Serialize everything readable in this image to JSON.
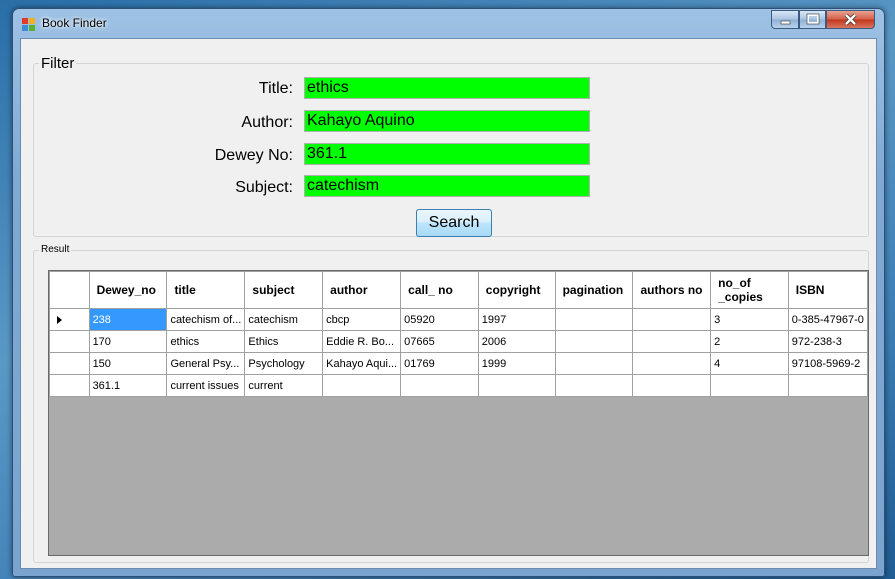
{
  "window": {
    "title": "Book Finder"
  },
  "filter": {
    "legend": "Filter",
    "fields": [
      {
        "label": "Title:",
        "value": "ethics"
      },
      {
        "label": "Author:",
        "value": "Kahayo Aquino"
      },
      {
        "label": "Dewey No:",
        "value": "361.1"
      },
      {
        "label": "Subject:",
        "value": "catechism"
      }
    ],
    "search_label": "Search",
    "input_color": "#00ff00"
  },
  "result": {
    "legend": "Result",
    "columns": [
      "Dewey_no",
      "title",
      "subject",
      "author",
      "call_ no",
      "copyright",
      "pagination",
      "authors no",
      "no_of _copies",
      "ISBN"
    ],
    "rows": [
      [
        "238",
        "catechism of...",
        "catechism",
        "cbcp",
        "05920",
        "1997",
        "",
        "",
        "3",
        "0-385-47967-0"
      ],
      [
        "170",
        "ethics",
        "Ethics",
        "Eddie R. Bo...",
        "07665",
        "2006",
        "",
        "",
        "2",
        "972-238-3"
      ],
      [
        "150",
        "General Psy...",
        "Psychology",
        "Kahayo Aqui...",
        "01769",
        "1999",
        "",
        "",
        "4",
        "97108-5969-2"
      ],
      [
        "361.1",
        "current issues",
        "current",
        "",
        "",
        "",
        "",
        "",
        "",
        ""
      ]
    ],
    "selected_row": 0,
    "selected_col": 0
  }
}
